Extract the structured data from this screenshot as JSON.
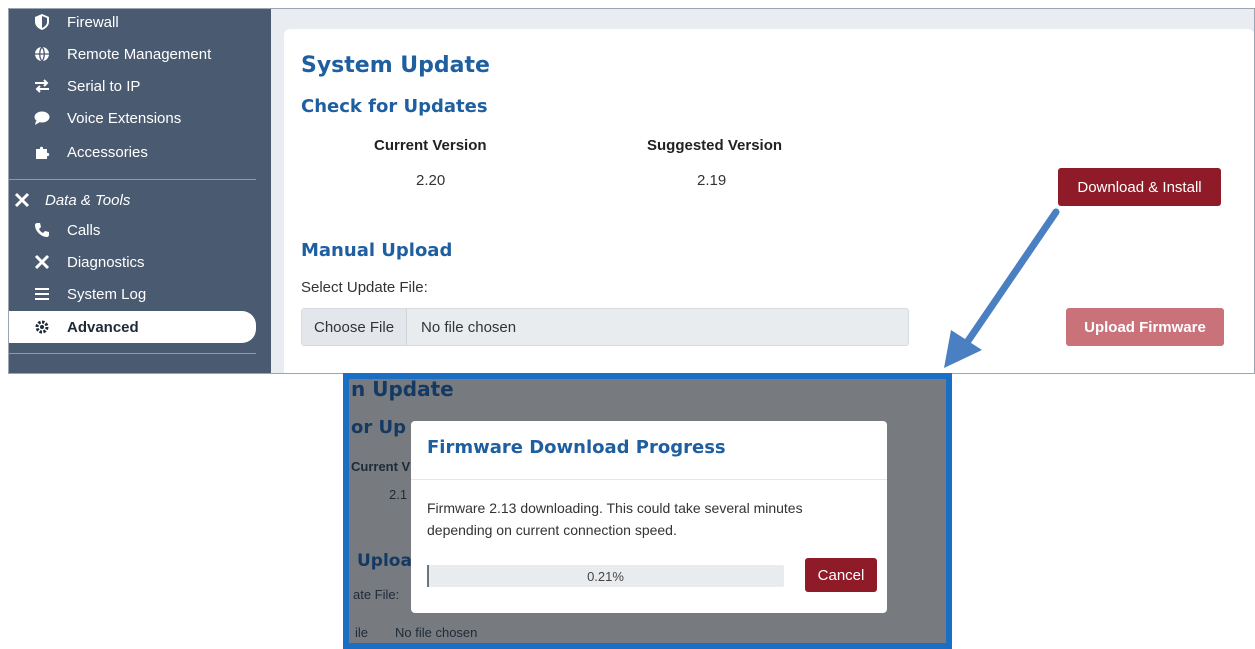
{
  "sidebar": {
    "items": [
      {
        "label": "Firewall",
        "icon": "shield-icon"
      },
      {
        "label": "Remote Management",
        "icon": "globe-icon"
      },
      {
        "label": "Serial to IP",
        "icon": "swap-arrows-icon"
      },
      {
        "label": "Voice Extensions",
        "icon": "chat-bubble-icon"
      },
      {
        "label": "Accessories",
        "icon": "puzzle-icon"
      }
    ],
    "section_header": {
      "label": "Data & Tools",
      "icon": "tools-icon"
    },
    "tools": [
      {
        "label": "Calls",
        "icon": "phone-icon"
      },
      {
        "label": "Diagnostics",
        "icon": "tools-icon"
      },
      {
        "label": "System Log",
        "icon": "list-icon"
      },
      {
        "label": "Advanced",
        "icon": "gear-icon"
      }
    ]
  },
  "page": {
    "title": "System Update",
    "check_title": "Check for Updates",
    "current_version_label": "Current Version",
    "current_version": "2.20",
    "suggested_version_label": "Suggested Version",
    "suggested_version": "2.19",
    "download_button": "Download & Install",
    "manual_title": "Manual Upload",
    "select_label": "Select Update File:",
    "choose_file_button": "Choose File",
    "no_file_text": "No file chosen",
    "upload_button": "Upload Firmware"
  },
  "background_fragments": {
    "title_fragment": "n Update",
    "check_fragment": "or Up",
    "current_fragment": "Current V",
    "version_fragment": "2.1",
    "manual_fragment": "Uploa",
    "select_fragment": "ate File:",
    "file_fragment": "ile",
    "no_file_fragment": "No file chosen"
  },
  "modal": {
    "title": "Firmware Download Progress",
    "message": "Firmware 2.13 downloading. This could take several minutes depending on current connection speed.",
    "progress_text": "0.21%",
    "progress_fraction": 0.0021,
    "cancel_button": "Cancel"
  },
  "colors": {
    "sidebar_bg": "#4a5a70",
    "heading_blue": "#1f5fa0",
    "danger_red": "#8e1b27",
    "callout_blue": "#1a6fc4"
  }
}
